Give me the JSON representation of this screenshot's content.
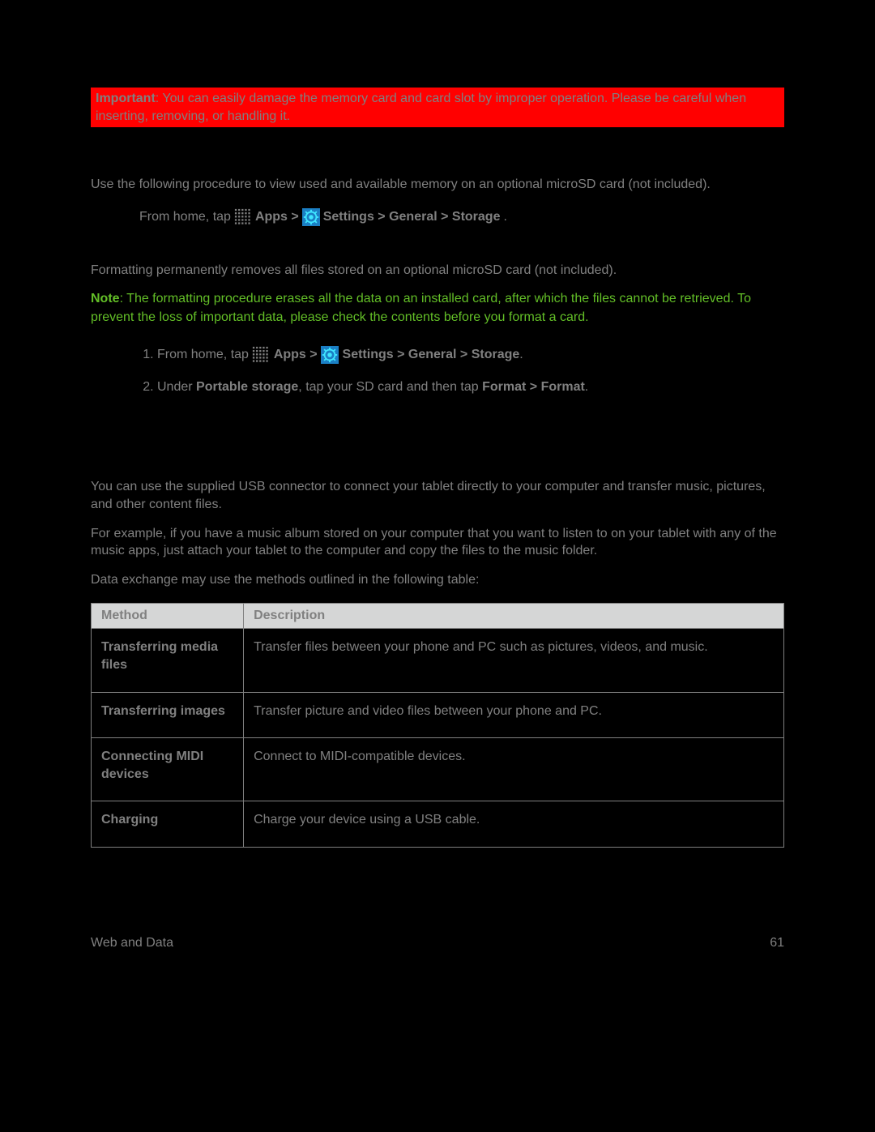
{
  "warning": {
    "label": "Important",
    "text": ": You can easily damage the memory card and card slot by improper operation. Please be careful when inserting, removing, or handling it."
  },
  "view_memory": {
    "intro": "Use the following procedure to view used and available memory on an optional microSD card (not included).",
    "step_prefix": "From home, tap ",
    "apps_label": "Apps > ",
    "settings_path": "Settings > General > Storage",
    "period": "."
  },
  "format": {
    "intro": "Formatting permanently removes all files stored on an optional microSD card (not included).",
    "note_label": "Note",
    "note_text": ": The formatting procedure erases all the data on an installed card, after which the files cannot be retrieved. To prevent the loss of important data, please check the contents before you format a card.",
    "step1_prefix": "From home, tap ",
    "step1_apps": "Apps > ",
    "step1_settings": "Settings > General > Storage",
    "step1_period": ".",
    "step2_a": "Under ",
    "step2_b": "Portable storage",
    "step2_c": ", tap your SD card and then tap ",
    "step2_d": "Format > Format",
    "step2_e": "."
  },
  "transfer": {
    "p1": "You can use the supplied USB connector to connect your tablet directly to your computer and transfer music, pictures, and other content files.",
    "p2": "For example, if you have a music album stored on your computer that you want to listen to on your tablet with any of the music apps, just attach your tablet to the computer and copy the files to the music folder.",
    "p3": "Data exchange may use the methods outlined in the following table:"
  },
  "table": {
    "head_method": "Method",
    "head_desc": "Description",
    "rows": [
      {
        "method": "Transferring media files",
        "desc": "Transfer files between your phone and PC such as pictures, videos, and music."
      },
      {
        "method": "Transferring images",
        "desc": "Transfer picture and video files between your phone and PC."
      },
      {
        "method": "Connecting MIDI devices",
        "desc": "Connect to MIDI-compatible devices."
      },
      {
        "method": "Charging",
        "desc": "Charge your device using a USB cable."
      }
    ]
  },
  "footer": {
    "left": "Web and Data",
    "right": "61"
  }
}
